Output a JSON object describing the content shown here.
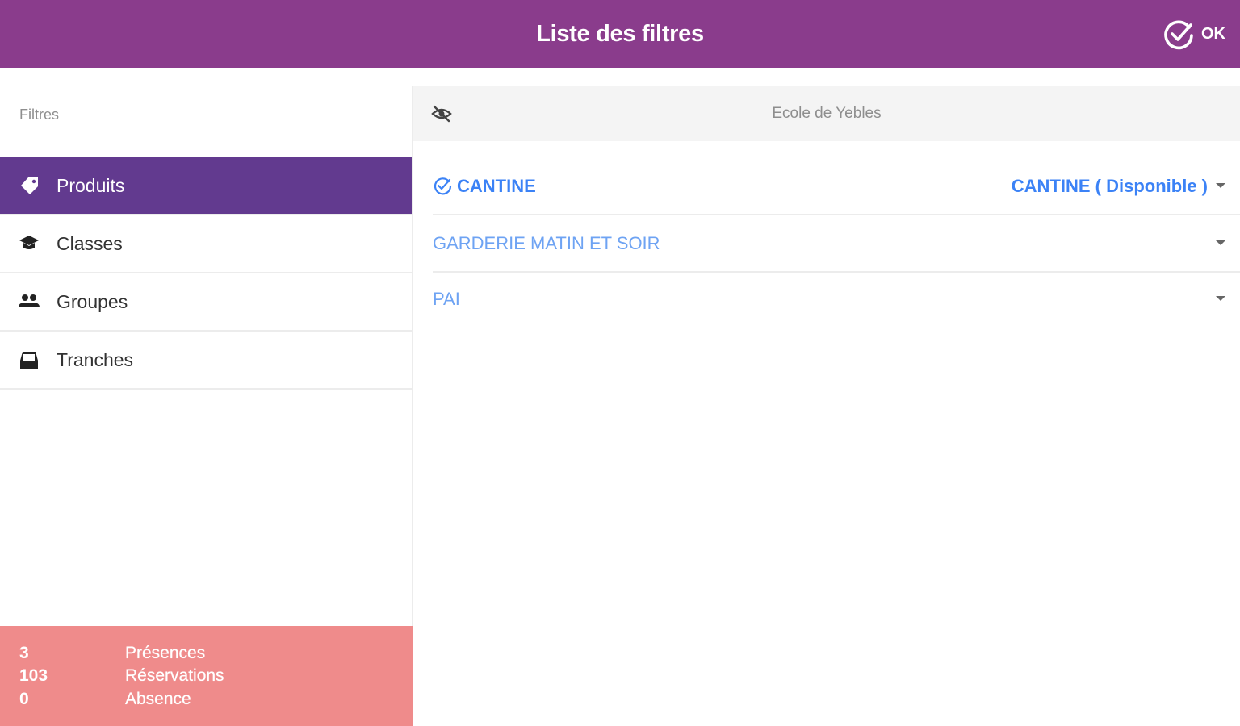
{
  "header": {
    "title": "Liste des filtres",
    "ok_label": "OK",
    "background_color": "#8a3c8c"
  },
  "sidebar": {
    "heading": "Filtres",
    "items": [
      {
        "label": "Produits",
        "icon": "tag-icon",
        "active": true
      },
      {
        "label": "Classes",
        "icon": "graduation-cap-icon",
        "active": false
      },
      {
        "label": "Groupes",
        "icon": "people-icon",
        "active": false
      },
      {
        "label": "Tranches",
        "icon": "inbox-icon",
        "active": false
      }
    ],
    "active_color": "#623a8f"
  },
  "stats": {
    "background_color": "#ef8b8b",
    "rows": [
      {
        "value": "3",
        "label": "Présences"
      },
      {
        "value": "103",
        "label": "Réservations"
      },
      {
        "value": "0",
        "label": "Absence"
      }
    ]
  },
  "main": {
    "school": "Ecole de Yebles",
    "eye_icon": "eye-off-icon",
    "products": [
      {
        "name": "CANTINE",
        "checked": true,
        "value": "CANTINE ( Disponible )"
      },
      {
        "name": "GARDERIE MATIN ET SOIR",
        "checked": false,
        "value": ""
      },
      {
        "name": "PAI",
        "checked": false,
        "value": ""
      }
    ],
    "link_color": "#3b82f6"
  }
}
